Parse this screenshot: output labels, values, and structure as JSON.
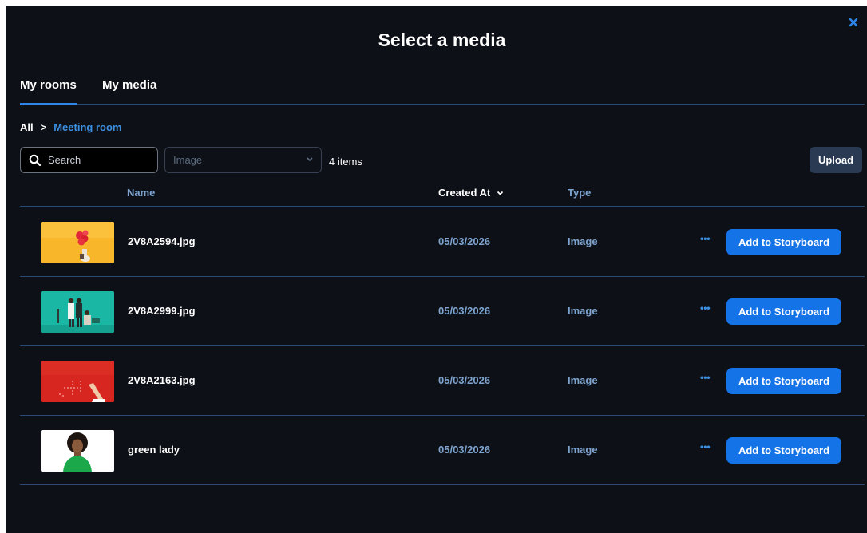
{
  "dialog": {
    "title": "Select a media",
    "close_icon": "close-icon"
  },
  "tabs": [
    {
      "label": "My rooms",
      "active": true
    },
    {
      "label": "My media",
      "active": false
    }
  ],
  "breadcrumb": {
    "root": "All",
    "separator": ">",
    "current": "Meeting room"
  },
  "toolbar": {
    "search_placeholder": "Search",
    "type_filter": "Image",
    "item_count": "4 items",
    "upload_label": "Upload"
  },
  "table": {
    "headers": {
      "name": "Name",
      "created_at": "Created At",
      "type": "Type"
    },
    "sort_icon": "chevron-down-icon",
    "rows": [
      {
        "name": "2V8A2594.jpg",
        "created_at": "05/03/2026",
        "type": "Image",
        "action": "Add to Storyboard",
        "more": "•••"
      },
      {
        "name": "2V8A2999.jpg",
        "created_at": "05/03/2026",
        "type": "Image",
        "action": "Add to Storyboard",
        "more": "•••"
      },
      {
        "name": "2V8A2163.jpg",
        "created_at": "05/03/2026",
        "type": "Image",
        "action": "Add to Storyboard",
        "more": "•••"
      },
      {
        "name": "green lady",
        "created_at": "05/03/2026",
        "type": "Image",
        "action": "Add to Storyboard",
        "more": "•••"
      }
    ]
  },
  "colors": {
    "background": "#0d1117",
    "accent": "#1473e6",
    "link": "#3d8fe0",
    "divider": "#2c4a73"
  }
}
